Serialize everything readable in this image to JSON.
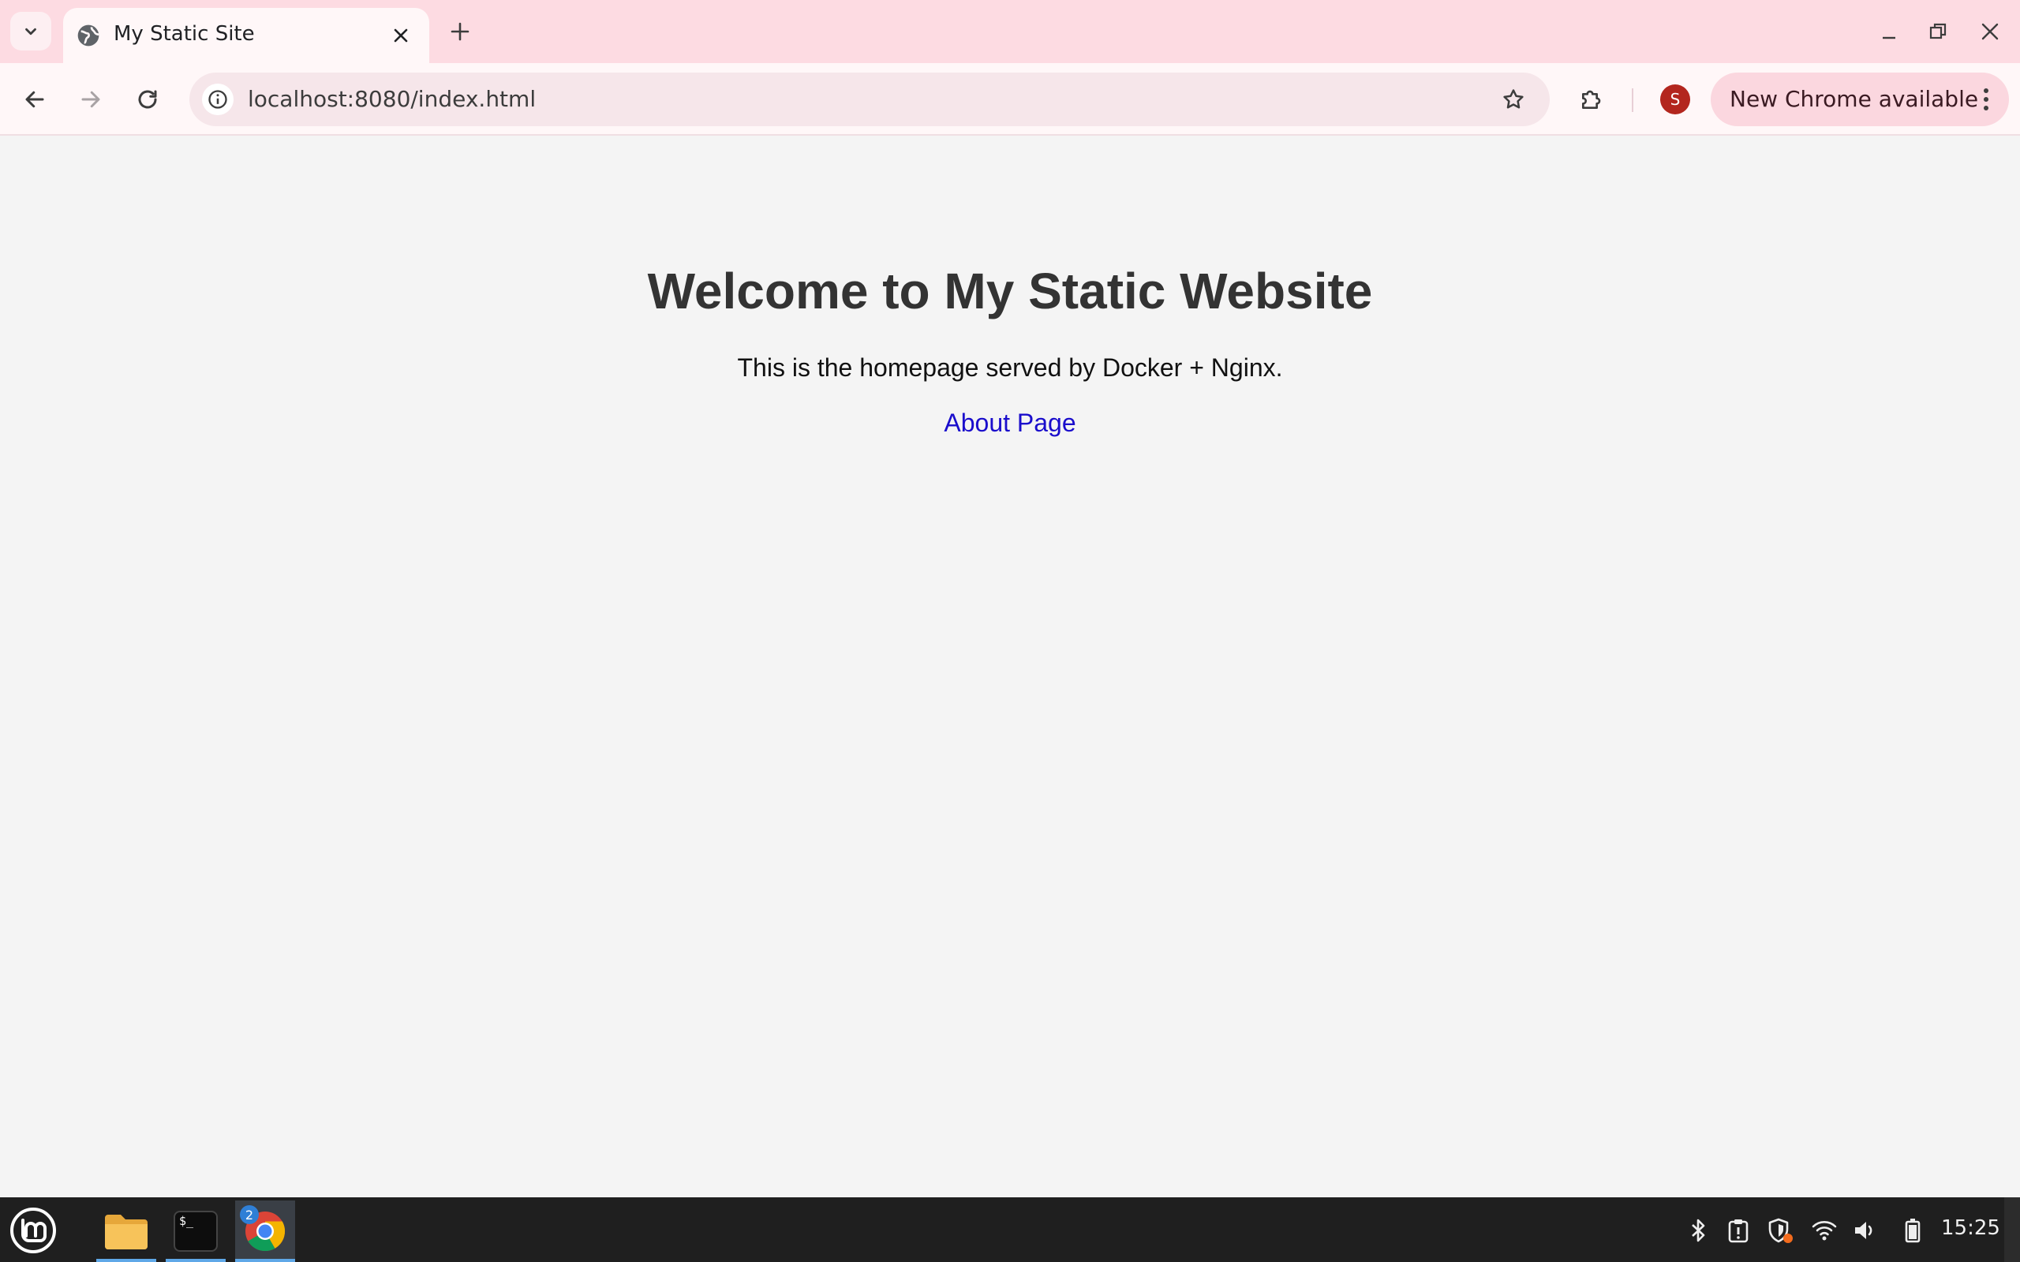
{
  "browser": {
    "tab": {
      "title": "My Static Site"
    },
    "address_bar": {
      "url": "localhost:8080/index.html"
    },
    "profile_initial": "S",
    "update_chip": {
      "label": "New Chrome available"
    }
  },
  "page": {
    "heading": "Welcome to My Static Website",
    "intro": "This is the homepage served by Docker + Nginx.",
    "link_label": "About Page"
  },
  "taskbar": {
    "apps": [
      {
        "name": "files",
        "icon": "folder-icon"
      },
      {
        "name": "terminal",
        "icon": "terminal-icon",
        "glyph": "$_"
      },
      {
        "name": "chrome",
        "icon": "chrome-icon",
        "badge": "2"
      }
    ],
    "tray": [
      "bluetooth-icon",
      "clipboard-icon",
      "shield-icon",
      "wifi-icon",
      "volume-icon",
      "battery-icon"
    ],
    "clock": "15:25"
  },
  "colors": {
    "tabstrip": "#fddbe2",
    "toolbar": "#fff7f8",
    "link": "#1a0dcc",
    "heading": "#333333",
    "page_bg": "#f4f4f4",
    "taskbar": "#1f1f1f",
    "avatar": "#b3261e"
  }
}
